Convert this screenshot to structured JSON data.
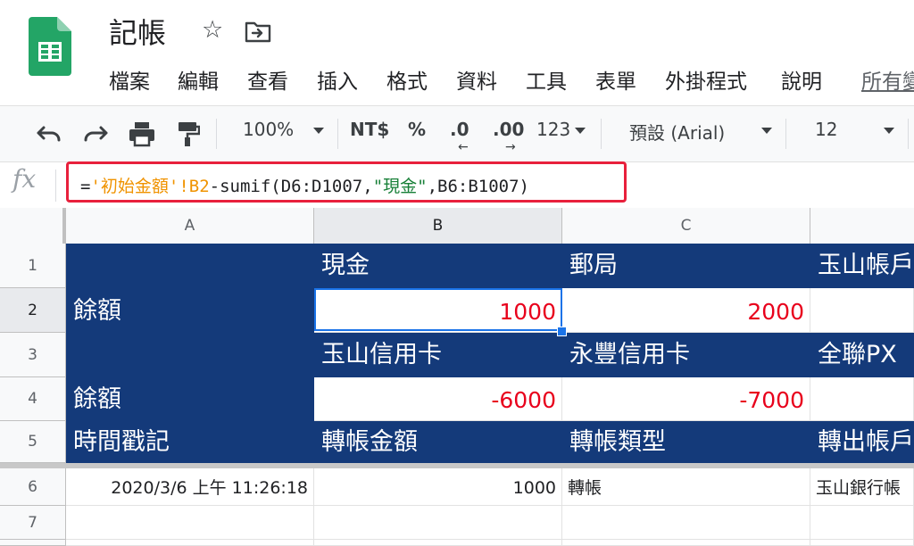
{
  "header": {
    "title": "記帳"
  },
  "menu": [
    "檔案",
    "編輯",
    "查看",
    "插入",
    "格式",
    "資料",
    "工具",
    "表單",
    "外掛程式",
    "說明",
    "所有變"
  ],
  "toolbar": {
    "zoom": "100%",
    "currency": "NT$",
    "percent": "%",
    "decrease_decimal": ".0",
    "increase_decimal": ".00",
    "more_formats": "123",
    "font": "預設 (Arial)",
    "font_size": "12"
  },
  "formula_bar": {
    "fx_label": "fx",
    "equals": "=",
    "ref": "'初始金額'!B2",
    "part_mid": "-sumif(D6:D1007,",
    "string": "\"現金\"",
    "part_end": ",B6:B1007)"
  },
  "columns": [
    "A",
    "B",
    "C"
  ],
  "rows": [
    "1",
    "2",
    "3",
    "4",
    "5",
    "6",
    "7"
  ],
  "cells": {
    "A2": "餘額",
    "A4": "餘額",
    "A5": "時間戳記",
    "A6": "2020/3/6 上午 11:26:18",
    "B1": "現金",
    "B2": "1000",
    "B3": "玉山信用卡",
    "B4": "-6000",
    "B5": "轉帳金額",
    "B6": "1000",
    "C1": "郵局",
    "C2": "2000",
    "C3": "永豐信用卡",
    "C4": "-7000",
    "C5": "轉帳類型",
    "C6": "轉帳",
    "D1": "玉山帳戶",
    "D3": "全聯PX",
    "D5": "轉出帳戶",
    "D6": "玉山銀行帳"
  },
  "colors": {
    "header_fill": "#143a7a",
    "negative_red": "#e8001c",
    "selection_blue": "#1a73e8",
    "formula_box": "#e8203c"
  }
}
